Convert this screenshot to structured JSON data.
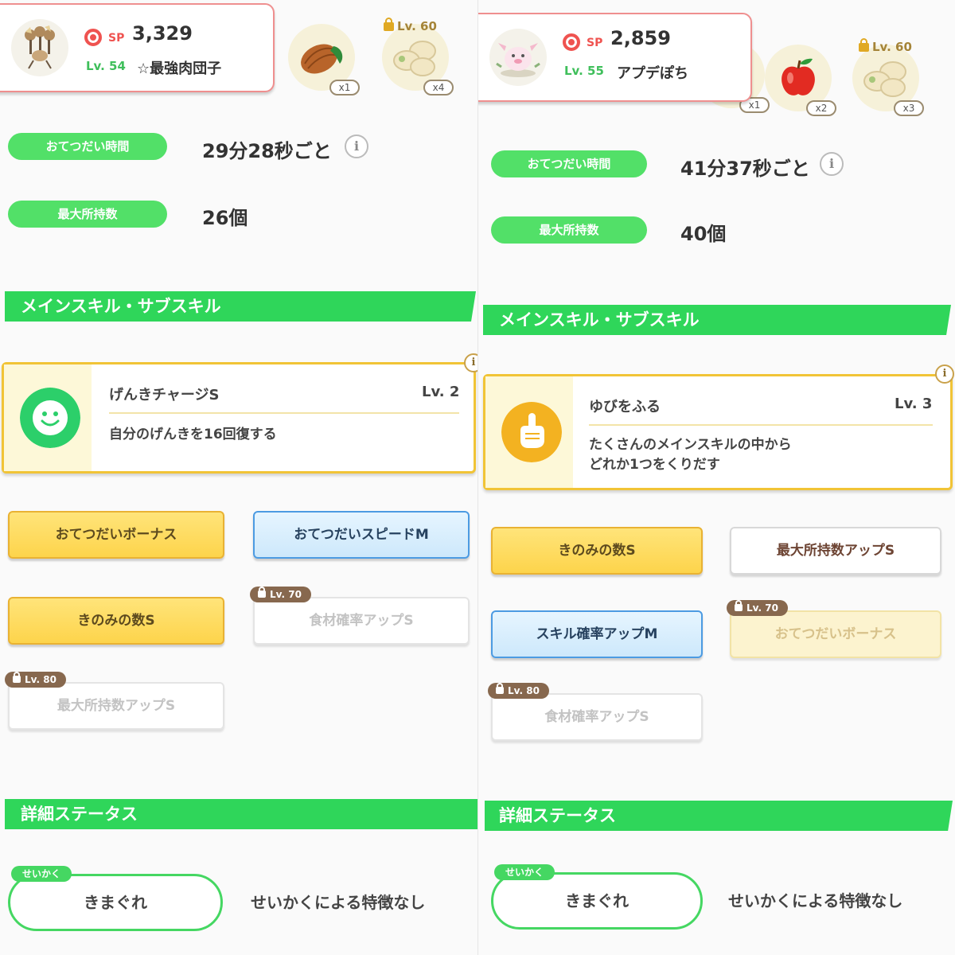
{
  "left": {
    "pokemon": {
      "sp_label": "SP",
      "sp": "3,329",
      "level": "Lv. 54",
      "nickname": "☆最強肉団子"
    },
    "ingredients": [
      {
        "name": "cacao",
        "count": "x1"
      },
      {
        "name": "potato",
        "count": "x4",
        "unlock": "Lv. 60"
      }
    ],
    "stats": {
      "help_label": "おてつだい時間",
      "help_value": "29分28秒ごと",
      "carry_label": "最大所持数",
      "carry_value": "26個"
    },
    "section_skills": "メインスキル・サブスキル",
    "main_skill": {
      "name": "げんきチャージS",
      "level": "Lv. 2",
      "desc_line1": "自分のげんきを16回復する",
      "icon": "smile-icon"
    },
    "subskills": [
      {
        "label": "おてつだいボーナス"
      },
      {
        "label": "おてつだいスピードM"
      },
      {
        "label": "きのみの数S"
      },
      {
        "label": "食材確率アップS",
        "lock": "Lv. 70"
      },
      {
        "label": "最大所持数アップS",
        "lock": "Lv. 80"
      }
    ],
    "section_detail": "詳細ステータス",
    "nature": {
      "tag": "せいかく",
      "name": "きまぐれ",
      "desc": "せいかくによる特徴なし"
    }
  },
  "right": {
    "pokemon": {
      "sp_label": "SP",
      "sp": "2,859",
      "level": "Lv. 55",
      "nickname": "アプデぽち"
    },
    "ingredients": [
      {
        "name": "unknown",
        "count": "x1"
      },
      {
        "name": "apple",
        "count": "x2"
      },
      {
        "name": "potato",
        "count": "x3",
        "unlock": "Lv. 60"
      }
    ],
    "stats": {
      "help_label": "おてつだい時間",
      "help_value": "41分37秒ごと",
      "carry_label": "最大所持数",
      "carry_value": "40個"
    },
    "section_skills": "メインスキル・サブスキル",
    "main_skill": {
      "name": "ゆびをふる",
      "level": "Lv. 3",
      "desc_line1": "たくさんのメインスキルの中から",
      "desc_line2": "どれか1つをくりだす",
      "icon": "finger-icon"
    },
    "subskills": [
      {
        "label": "きのみの数S"
      },
      {
        "label": "最大所持数アップS"
      },
      {
        "label": "スキル確率アップM"
      },
      {
        "label": "おてつだいボーナス",
        "lock": "Lv. 70"
      },
      {
        "label": "食材確率アップS",
        "lock": "Lv. 80"
      }
    ],
    "section_detail": "詳細ステータス",
    "nature": {
      "tag": "せいかく",
      "name": "きまぐれ",
      "desc": "せいかくによる特徴なし"
    }
  },
  "info_glyph": "i",
  "colors": {
    "green": "#2fd65a",
    "gold": "#f1c436",
    "blue": "#4c9be2",
    "sp": "#ef5350"
  }
}
